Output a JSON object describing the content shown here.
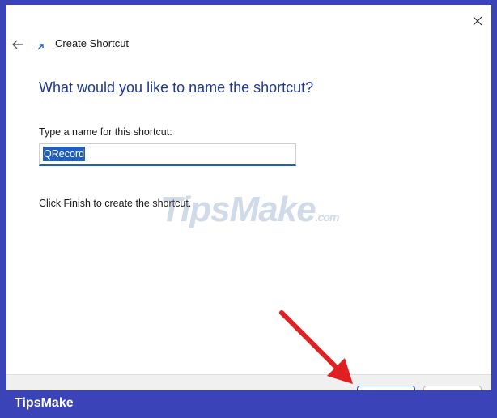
{
  "window": {
    "title": "Create Shortcut",
    "close_glyph": "✕",
    "back_icon": "back-arrow-icon",
    "title_icon": "shortcut-icon"
  },
  "main": {
    "heading": "What would you like to name the shortcut?",
    "name_label": "Type a name for this shortcut:",
    "name_value": "QRecord",
    "finish_hint": "Click Finish to create the shortcut."
  },
  "watermark": {
    "text": "TipsMake",
    "suffix": ".com"
  },
  "brand": {
    "text": "TipsMake"
  },
  "colors": {
    "accent": "#1f5fbf",
    "heading": "#1f3a93",
    "frame": "#3a44b8",
    "annotation": "#e02020"
  }
}
